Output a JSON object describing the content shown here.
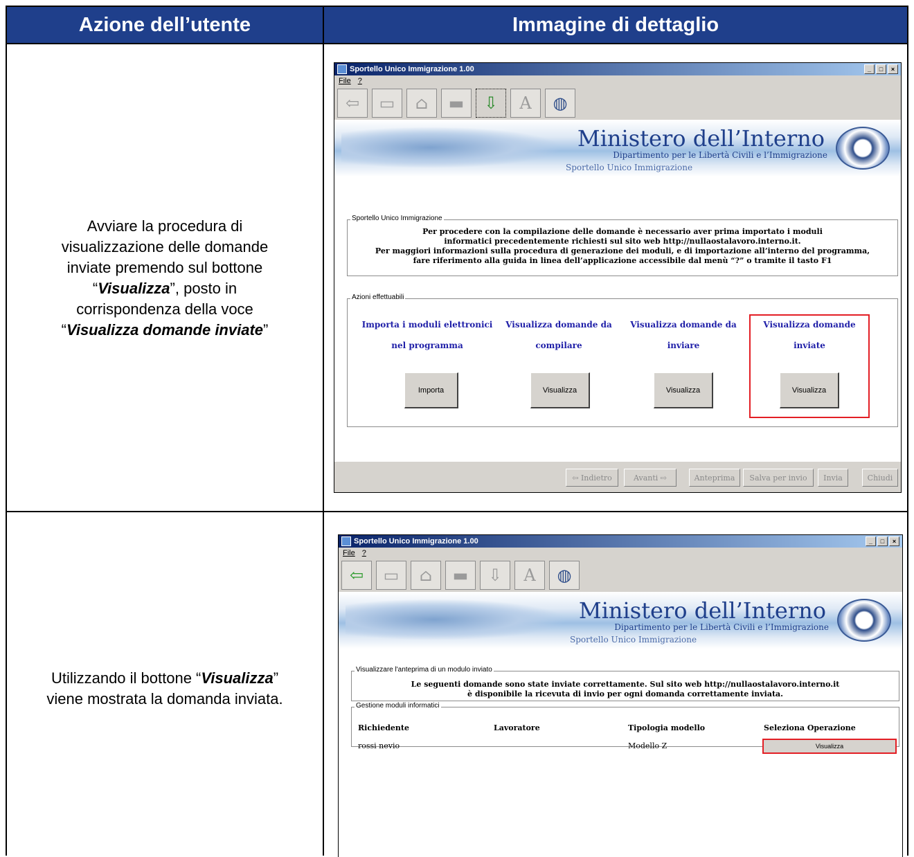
{
  "table": {
    "header_left": "Azione dell’utente",
    "header_right": "Immagine di dettaglio"
  },
  "row1": {
    "text_parts": [
      "Avviare la procedura di",
      "visualizzazione delle domande",
      "inviate premendo sul bottone",
      "“",
      "Visualizza",
      "”, posto in",
      "corrispondenza della voce",
      "“",
      "Visualizza domande inviate",
      "”"
    ]
  },
  "row2": {
    "text_parts": [
      "Utilizzando il bottone “",
      "Visualizza",
      "”",
      "viene mostrata la domanda inviata."
    ]
  },
  "app": {
    "title": "Sportello Unico Immigrazione 1.00",
    "menu": [
      "File",
      "?"
    ],
    "window_buttons": [
      "_",
      "□",
      "×"
    ],
    "banner_title": "Ministero dell’Interno",
    "banner_sub": "Dipartimento per le Libertà Civili e l’Immigrazione",
    "banner_sportello": "Sportello Unico Immigrazione"
  },
  "screen1": {
    "group1_label": "Sportello Unico Immigrazione",
    "info_lines": [
      "Per procedere con la compilazione delle domande è necessario aver prima importato i moduli",
      "informatici precedentemente richiesti sul sito web http://nullaostalavoro.interno.it.",
      "Per maggiori informazioni sulla procedura di generazione dei moduli, e di importazione all’interno del programma,",
      "fare riferimento alla guida in linea dell’applicazione accessibile dal menù “?” o tramite il tasto F1"
    ],
    "group2_label": "Azioni effettuabili",
    "actions": [
      {
        "title1": "Importa i moduli elettronici",
        "title2": "nel programma",
        "button": "Importa"
      },
      {
        "title1": "Visualizza domande da",
        "title2": "compilare",
        "button": "Visualizza"
      },
      {
        "title1": "Visualizza domande da",
        "title2": "inviare",
        "button": "Visualizza"
      },
      {
        "title1": "Visualizza domande",
        "title2": "inviate",
        "button": "Visualizza"
      }
    ],
    "nav": [
      "⇦ Indietro",
      "Avanti ⇨",
      "Anteprima",
      "Salva per invio",
      "Invia",
      "Chiudi"
    ]
  },
  "screen2": {
    "group1_label": "Visualizzare l'anteprima di un modulo inviato",
    "info_lines": [
      "Le seguenti domande sono state inviate correttamente. Sul sito web http://nullaostalavoro.interno.it",
      "è disponibile la ricevuta di invio per ogni domanda correttamente inviata."
    ],
    "group2_label": "Gestione moduli informatici",
    "columns": [
      "Richiedente",
      "Lavoratore",
      "Tipologia modello",
      "Seleziona Operazione"
    ],
    "row": {
      "richiedente": "rossi nevio",
      "lavoratore": "",
      "tipologia": "Modello Z",
      "operazione": "Visualizza"
    }
  },
  "colors": {
    "header_bg": "#1f3f8b",
    "highlight": "#e31e24",
    "action_title": "#1f1fa8"
  }
}
